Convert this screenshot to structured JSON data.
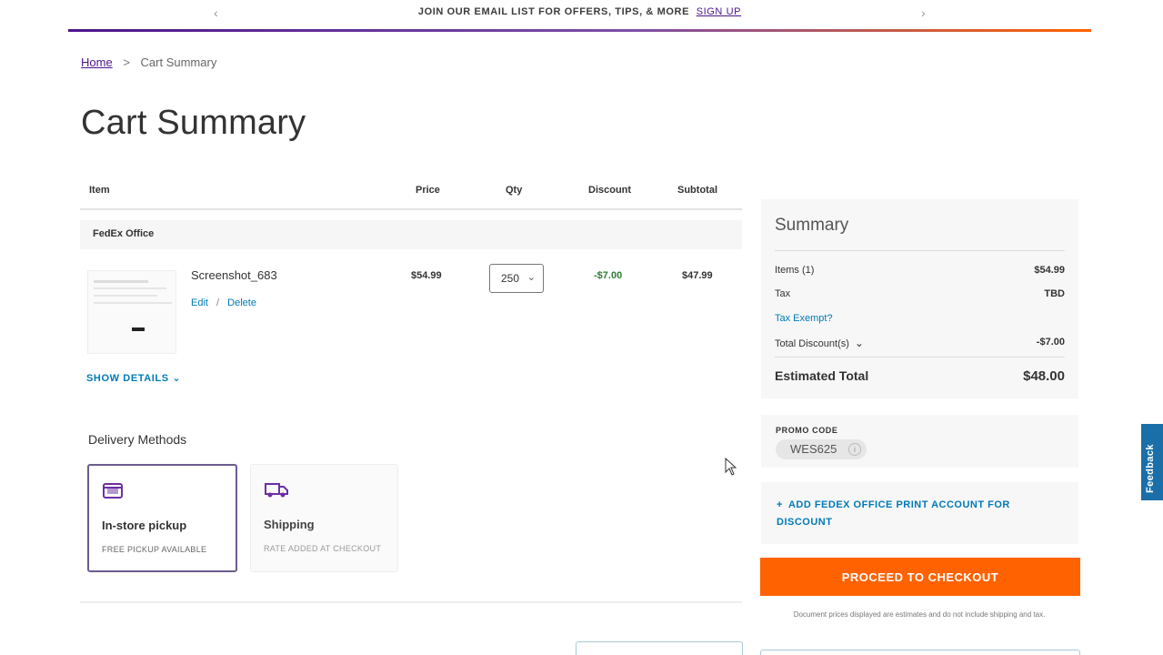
{
  "promo": {
    "text": "JOIN OUR EMAIL LIST FOR OFFERS, TIPS, & MORE",
    "link": "SIGN UP",
    "prev_icon": "chevron-left-icon",
    "next_icon": "chevron-right-icon",
    "prev_glyph": "‹",
    "next_glyph": "›",
    "gradient": [
      "#4d148c",
      "#ff6200"
    ]
  },
  "breadcrumb": {
    "home": "Home",
    "separator": ">",
    "current": "Cart Summary"
  },
  "page_title": "Cart Summary",
  "cart": {
    "columns": {
      "item": "Item",
      "price": "Price",
      "qty": "Qty",
      "discount": "Discount",
      "subtotal": "Subtotal"
    },
    "group": "FedEx Office",
    "items": [
      {
        "name": "Screenshot_683",
        "edit": "Edit",
        "divider": "/",
        "delete": "Delete",
        "price": "$54.99",
        "qty": "250",
        "discount": "-$7.00",
        "subtotal": "$47.99"
      }
    ],
    "show_details": "SHOW DETAILS"
  },
  "delivery": {
    "heading": "Delivery Methods",
    "options": [
      {
        "title": "In-store pickup",
        "subtitle": "FREE PICKUP AVAILABLE",
        "icon": "store-icon",
        "selected": true
      },
      {
        "title": "Shipping",
        "subtitle": "RATE ADDED AT CHECKOUT",
        "icon": "truck-icon",
        "selected": false
      }
    ]
  },
  "summary": {
    "title": "Summary",
    "items_label": "Items (1)",
    "items_value": "$54.99",
    "tax_label": "Tax",
    "tax_value": "TBD",
    "tax_exempt": "Tax Exempt?",
    "discount_label": "Total Discount(s)",
    "discount_value": "-$7.00",
    "estimated_label": "Estimated Total",
    "estimated_value": "$48.00"
  },
  "promo_code": {
    "label": "PROMO CODE",
    "code": "WES625"
  },
  "account": {
    "link": "ADD FEDEX OFFICE PRINT ACCOUNT FOR DISCOUNT"
  },
  "checkout": {
    "button": "PROCEED TO CHECKOUT",
    "disclaimer": "Document prices displayed are estimates and do not include shipping and tax."
  },
  "feedback": "Feedback",
  "colors": {
    "brand_purple": "#4d148c",
    "brand_orange": "#ff6200",
    "link_blue": "#007ab7",
    "discount_green": "#2e7d32"
  }
}
